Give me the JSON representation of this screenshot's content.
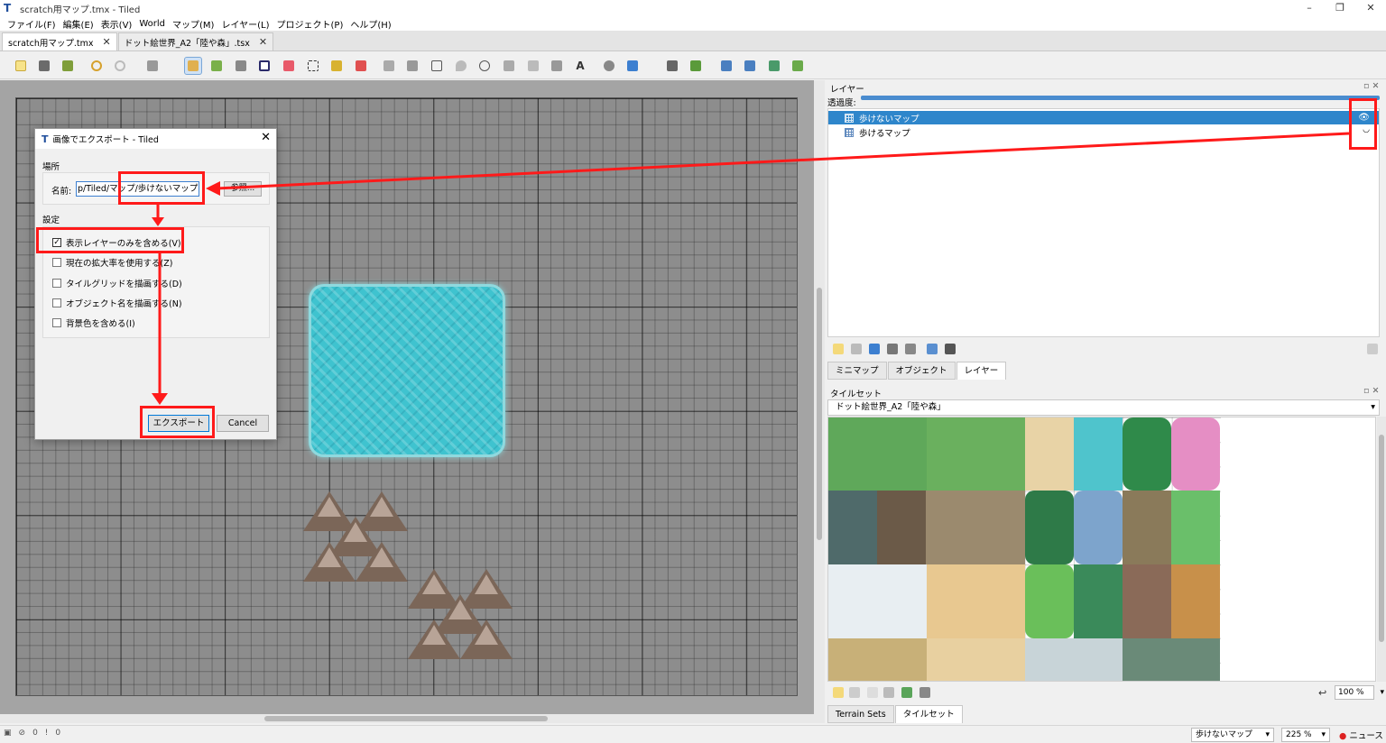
{
  "window": {
    "title": "scratch用マップ.tmx - Tiled",
    "minimize": "–",
    "maximize": "❐",
    "close": "✕"
  },
  "menu": [
    "ファイル(F)",
    "編集(E)",
    "表示(V)",
    "World",
    "マップ(M)",
    "レイヤー(L)",
    "プロジェクト(P)",
    "ヘルプ(H)"
  ],
  "tabs": [
    {
      "label": "scratch用マップ.tmx",
      "close": "✕"
    },
    {
      "label": "ドット絵世界_A2「陸や森」.tsx",
      "close": "✕"
    }
  ],
  "layers_panel": {
    "title": "レイヤー",
    "opacity_label": "透過度:",
    "layers": [
      {
        "name": "歩けないマップ",
        "selected": true
      },
      {
        "name": "歩けるマップ",
        "selected": false
      }
    ],
    "tabs": [
      "ミニマップ",
      "オブジェクト",
      "レイヤー"
    ]
  },
  "tileset_panel": {
    "title": "タイルセット",
    "selected_tileset": "ドット絵世界_A2「陸や森」",
    "zoom": "100 %",
    "bottom_tabs": [
      "Terrain Sets",
      "タイルセット"
    ]
  },
  "status": {
    "errors": "0",
    "warnings": "0",
    "current_layer": "歩けないマップ",
    "zoom": "225 %",
    "news": "ニュース"
  },
  "dialog": {
    "title": "画像でエクスポート - Tiled",
    "location_label": "場所",
    "name_label": "名前:",
    "name_value": "p/Tiled/マップ/歩けないマップ.png",
    "browse_label": "参照...",
    "settings_label": "設定",
    "options": [
      {
        "label": "表示レイヤーのみを含める(V)",
        "checked": true
      },
      {
        "label": "現在の拡大率を使用する(Z)",
        "checked": false
      },
      {
        "label": "タイルグリッドを描画する(D)",
        "checked": false
      },
      {
        "label": "オブジェクト名を描画する(N)",
        "checked": false
      },
      {
        "label": "背景色を含める(I)",
        "checked": false
      }
    ],
    "export_label": "エクスポート",
    "cancel_label": "Cancel"
  },
  "colors": {
    "highlight": "#ff1a1a",
    "selection": "#2e86cb",
    "accent": "#0078d7"
  }
}
